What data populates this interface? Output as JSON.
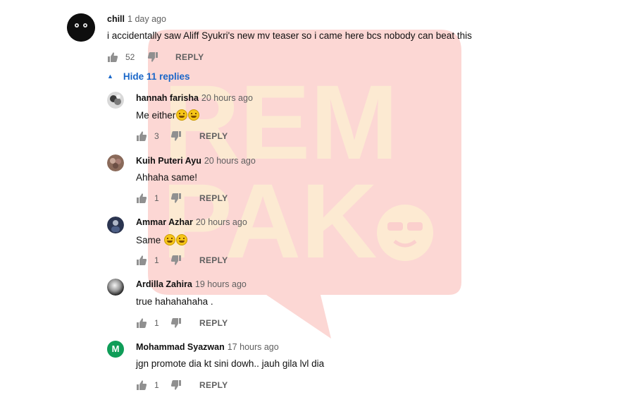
{
  "top_comment": {
    "author": "chill",
    "time": "1 day ago",
    "text": "i accidentally saw Aliff Syukri's new mv teaser so i came here bcs nobody can beat this",
    "likes": "52",
    "reply_label": "REPLY"
  },
  "hide_replies_label": "Hide 11 replies",
  "replies": [
    {
      "author": "hannah farisha",
      "time": "20 hours ago",
      "text": "Me either",
      "emoji_count": 2,
      "likes": "3",
      "reply_label": "REPLY"
    },
    {
      "author": "Kuih Puteri Ayu",
      "time": "20 hours ago",
      "text": "Ahhaha same!",
      "emoji_count": 0,
      "likes": "1",
      "reply_label": "REPLY"
    },
    {
      "author": "Ammar Azhar",
      "time": "20 hours ago",
      "text": "Same ",
      "emoji_count": 2,
      "likes": "1",
      "reply_label": "REPLY"
    },
    {
      "author": "Ardilla Zahira",
      "time": "19 hours ago",
      "text": "true hahahahaha .",
      "emoji_count": 0,
      "likes": "1",
      "reply_label": "REPLY"
    },
    {
      "author": "Mohammad Syazwan",
      "time": "17 hours ago",
      "text": "jgn promote dia kt sini dowh.. jauh gila lvl dia",
      "emoji_count": 0,
      "likes": "1",
      "reply_label": "REPLY",
      "avatar_letter": "M"
    }
  ],
  "watermark": {
    "text_line1": "REM",
    "text_line2": "PAK",
    "color": "#f9c4c0",
    "text_color": "#fbe7c4"
  },
  "colors": {
    "link": "#1a67c9",
    "meta": "#606060",
    "avatar_m": "#0f9d58"
  }
}
